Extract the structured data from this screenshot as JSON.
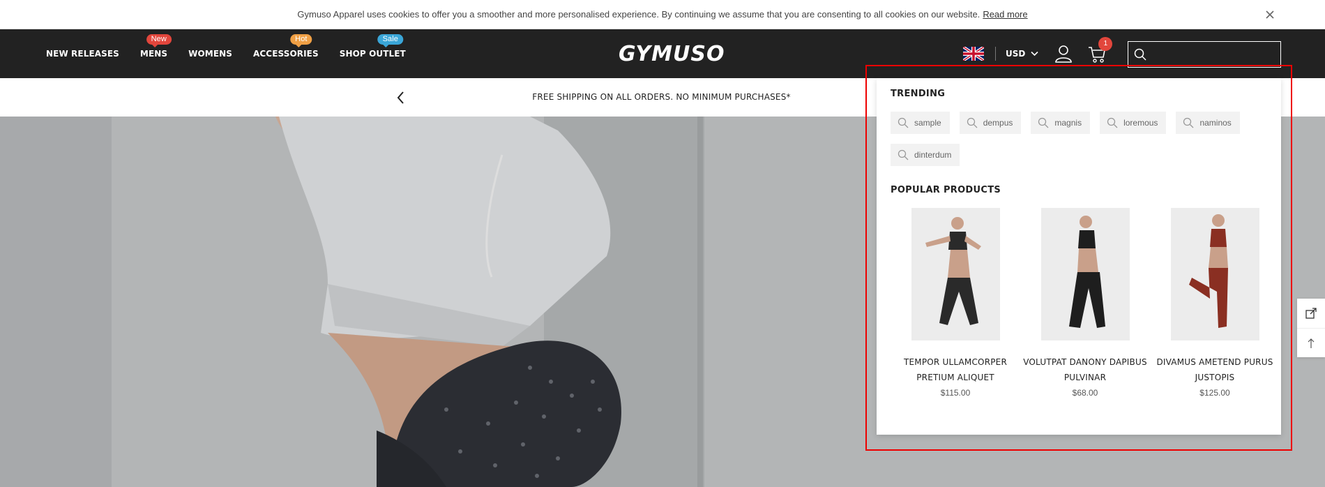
{
  "cookie": {
    "message": "Gymuso Apparel uses cookies to offer you a smoother and more personalised experience. By continuing we assume that you are consenting to all cookies on our website.",
    "link": "Read more"
  },
  "header": {
    "nav": [
      {
        "label": "NEW RELEASES"
      },
      {
        "label": "MENS",
        "badge": "New",
        "badge_color": "#e2463c"
      },
      {
        "label": "WOMENS"
      },
      {
        "label": "ACCESSORIES",
        "badge": "Hot",
        "badge_color": "#f0a045"
      },
      {
        "label": "SHOP OUTLET",
        "badge": "Sale",
        "badge_color": "#3aa6d8"
      }
    ],
    "logo": "GYMUSO",
    "currency": "USD",
    "cart_count": "1",
    "search_placeholder": ""
  },
  "announcement": {
    "text": "FREE SHIPPING ON ALL ORDERS. NO MINIMUM PURCHASES*"
  },
  "search_dropdown": {
    "trending_title": "TRENDING",
    "trending": [
      "sample",
      "dempus",
      "magnis",
      "loremous",
      "naminos",
      "dinterdum"
    ],
    "popular_title": "POPULAR PRODUCTS",
    "products": [
      {
        "name": "TEMPOR ULLAMCORPER PRETIUM ALIQUET",
        "price": "$115.00",
        "color": "#2a2a2a"
      },
      {
        "name": "VOLUTPAT DANONY DAPIBUS PULVINAR",
        "price": "$68.00",
        "color": "#1e1e1e"
      },
      {
        "name": "DIVAMUS AMETEND PURUS JUSTOPIS",
        "price": "$125.00",
        "color": "#8a2f22"
      }
    ]
  }
}
